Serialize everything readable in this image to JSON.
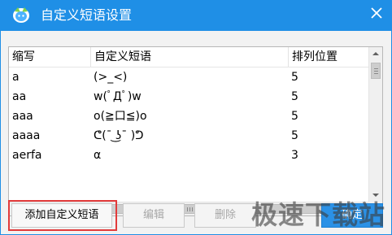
{
  "window": {
    "title": "自定义短语设置",
    "accent": "#1f8fe6"
  },
  "table": {
    "columns": [
      "缩写",
      "自定义短语",
      "排列位置"
    ],
    "rows": [
      {
        "abbr": "a",
        "phrase": "(>_<)",
        "position": "5"
      },
      {
        "abbr": "aa",
        "phrase": "w(ﾟДﾟ)w",
        "position": "5"
      },
      {
        "abbr": "aaa",
        "phrase": "o(≧口≦)o",
        "position": "5"
      },
      {
        "abbr": "aaaa",
        "phrase": "ᕦ(¯ ͜ʖ¯ )ᕤ",
        "position": "5"
      },
      {
        "abbr": "aerfa",
        "phrase": "α",
        "position": "3"
      }
    ]
  },
  "buttons": {
    "add": "添加自定义短语",
    "edit": "编辑",
    "delete": "删除",
    "ok": "确定"
  },
  "watermark": "极速下载站",
  "icons": {
    "app": "app-logo-icon",
    "close": "close-icon"
  }
}
